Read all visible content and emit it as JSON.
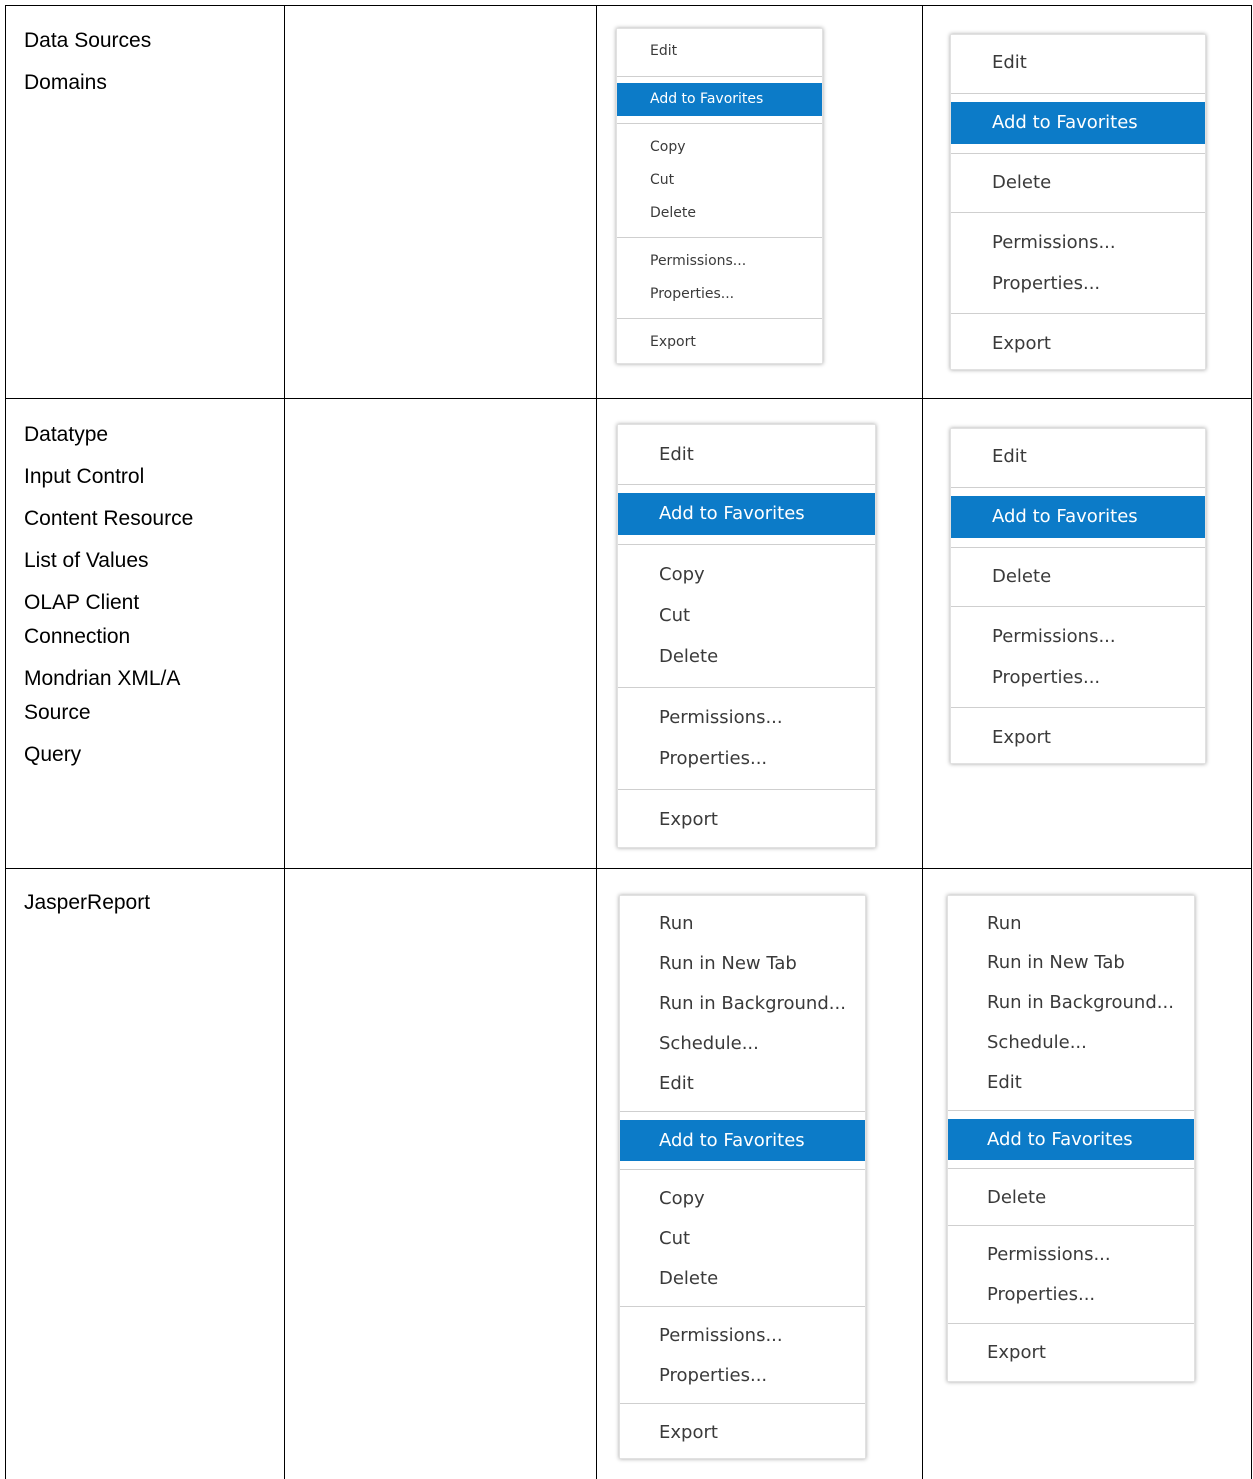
{
  "rows": [
    {
      "types": [
        "Data Sources",
        "Domains"
      ],
      "menu_a": [
        "Edit",
        "Add to Favorites",
        "Copy",
        "Cut",
        "Delete",
        "Permissions...",
        "Properties...",
        "Export"
      ],
      "menu_b": [
        "Edit",
        "Add to Favorites",
        "Delete",
        "Permissions...",
        "Properties...",
        "Export"
      ]
    },
    {
      "types": [
        "Datatype",
        "Input Control",
        "Content Resource",
        "List of Values",
        "OLAP Client Connection",
        "Mondrian XML/A Source",
        "Query"
      ],
      "menu_a": [
        "Edit",
        "Add to Favorites",
        "Copy",
        "Cut",
        "Delete",
        "Permissions...",
        "Properties...",
        "Export"
      ],
      "menu_b": [
        "Edit",
        "Add to Favorites",
        "Delete",
        "Permissions...",
        "Properties...",
        "Export"
      ]
    },
    {
      "types": [
        "JasperReport"
      ],
      "menu_a": [
        "Run",
        "Run in New Tab",
        "Run in Background...",
        "Schedule...",
        "Edit",
        "Add to Favorites",
        "Copy",
        "Cut",
        "Delete",
        "Permissions...",
        "Properties...",
        "Export"
      ],
      "menu_b": [
        "Run",
        "Run in New Tab",
        "Run in Background...",
        "Schedule...",
        "Edit",
        "Add to Favorites",
        "Delete",
        "Permissions...",
        "Properties...",
        "Export"
      ]
    }
  ],
  "highlight_color": "#0c7bc8"
}
